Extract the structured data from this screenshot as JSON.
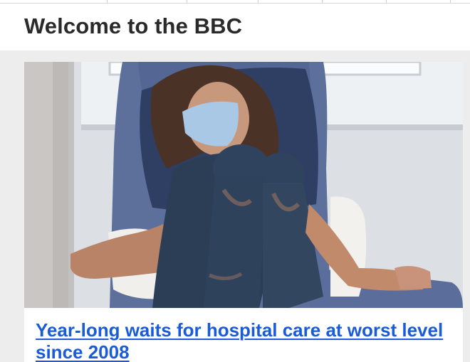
{
  "header": {
    "title": "Welcome to the BBC"
  },
  "story": {
    "headline": "Year-long waits for hospital care at worst level since 2008",
    "image": {
      "icon": "news-photo-woman-in-hospital-chair"
    }
  },
  "colors": {
    "link": "#1a5bd8",
    "title": "#2a2a2a",
    "page_bg": "#ededed"
  }
}
